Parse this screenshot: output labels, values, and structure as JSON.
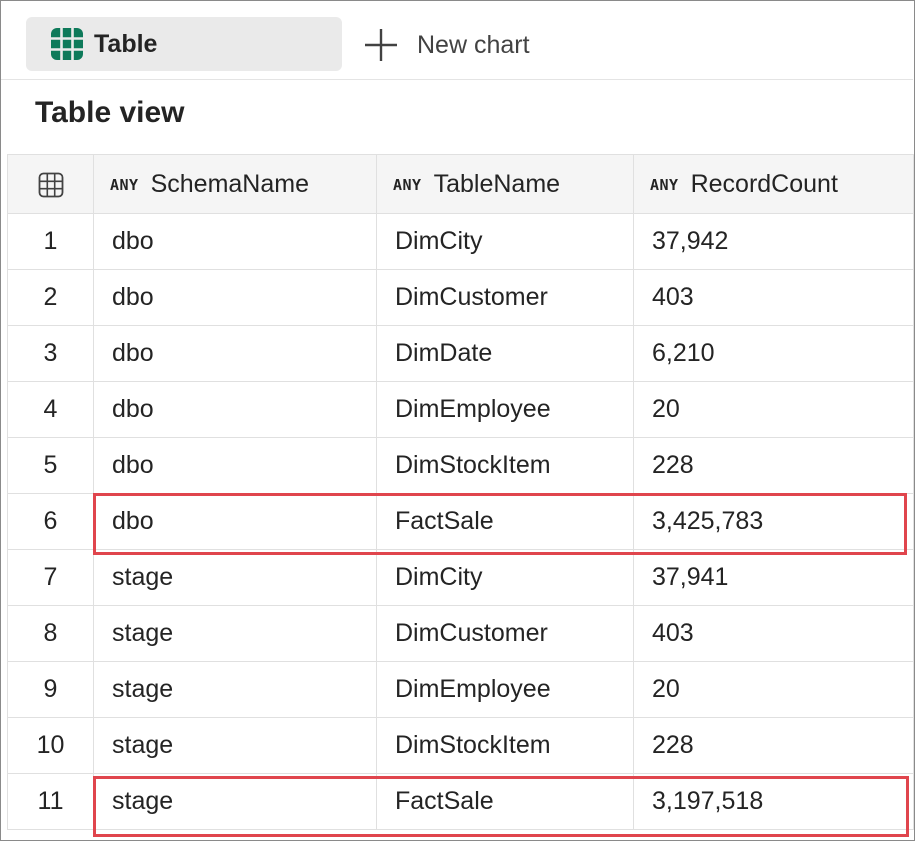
{
  "toolbar": {
    "table_tab_label": "Table",
    "new_chart_label": "New chart"
  },
  "view": {
    "title": "Table view"
  },
  "columns": [
    {
      "type": "ANY",
      "name": "SchemaName"
    },
    {
      "type": "ANY",
      "name": "TableName"
    },
    {
      "type": "ANY",
      "name": "RecordCount"
    }
  ],
  "rows": [
    {
      "n": "1",
      "schema": "dbo",
      "table": "DimCity",
      "count": "37,942",
      "highlighted": false
    },
    {
      "n": "2",
      "schema": "dbo",
      "table": "DimCustomer",
      "count": "403",
      "highlighted": false
    },
    {
      "n": "3",
      "schema": "dbo",
      "table": "DimDate",
      "count": "6,210",
      "highlighted": false
    },
    {
      "n": "4",
      "schema": "dbo",
      "table": "DimEmployee",
      "count": "20",
      "highlighted": false
    },
    {
      "n": "5",
      "schema": "dbo",
      "table": "DimStockItem",
      "count": "228",
      "highlighted": false
    },
    {
      "n": "6",
      "schema": "dbo",
      "table": "FactSale",
      "count": "3,425,783",
      "highlighted": true
    },
    {
      "n": "7",
      "schema": "stage",
      "table": "DimCity",
      "count": "37,941",
      "highlighted": false
    },
    {
      "n": "8",
      "schema": "stage",
      "table": "DimCustomer",
      "count": "403",
      "highlighted": false
    },
    {
      "n": "9",
      "schema": "stage",
      "table": "DimEmployee",
      "count": "20",
      "highlighted": false
    },
    {
      "n": "10",
      "schema": "stage",
      "table": "DimStockItem",
      "count": "228",
      "highlighted": false
    },
    {
      "n": "11",
      "schema": "stage",
      "table": "FactSale",
      "count": "3,197,518",
      "highlighted": true
    }
  ],
  "colors": {
    "table_icon": "#0e7a5a",
    "highlight": "#e0454d",
    "tab_active_bg": "#eaeaea"
  },
  "icons": {
    "table_tab": "table-grid-icon",
    "new_chart": "plus-icon",
    "row_header": "table-small-icon"
  }
}
